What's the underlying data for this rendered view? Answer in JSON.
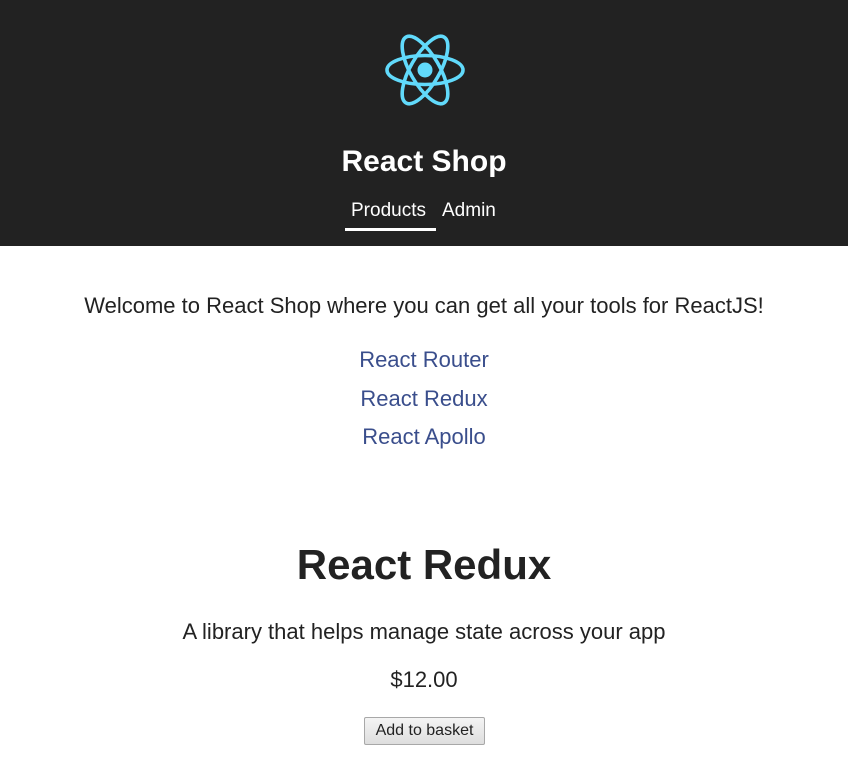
{
  "header": {
    "logo_icon": "react-atom-icon",
    "logo_color": "#61dafb",
    "title": "React Shop",
    "background": "#222222"
  },
  "nav": {
    "items": [
      {
        "label": "Products",
        "active": true
      },
      {
        "label": "Admin",
        "active": false
      }
    ]
  },
  "main": {
    "welcome": "Welcome to React Shop where you can get all your tools for ReactJS!",
    "products": [
      {
        "label": "React Router"
      },
      {
        "label": "React Redux"
      },
      {
        "label": "React Apollo"
      }
    ],
    "link_color": "#3a4e8c"
  },
  "product": {
    "name": "React Redux",
    "description": "A library that helps manage state across your app",
    "price": "$12.00",
    "add_button_label": "Add to basket"
  }
}
